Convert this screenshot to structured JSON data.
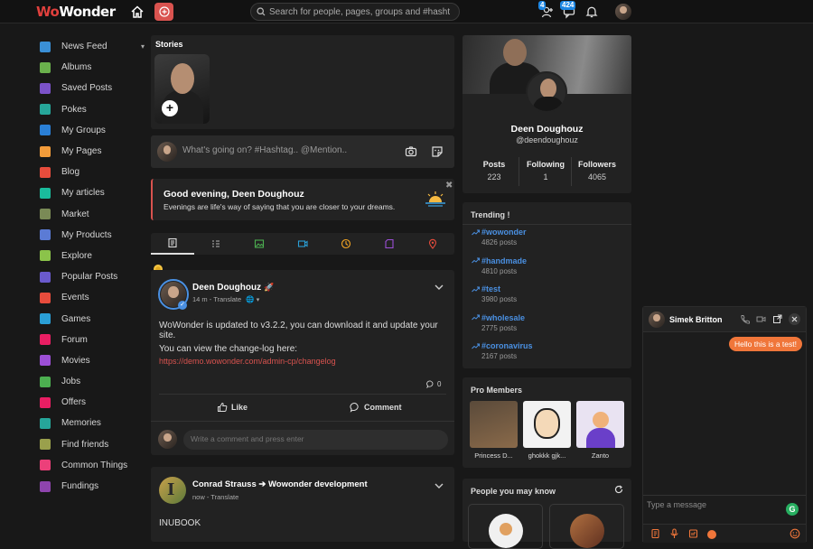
{
  "brand": {
    "logo_left": "Wo",
    "logo_right": "Wonder"
  },
  "topbar": {
    "search_placeholder": "Search for people, pages, groups and #hashtags",
    "friend_requests_count": "4",
    "messages_count": "424"
  },
  "sidebar": {
    "items": [
      {
        "label": "News Feed",
        "color": "#3a8fd6"
      },
      {
        "label": "Albums",
        "color": "#6ab04c"
      },
      {
        "label": "Saved Posts",
        "color": "#7b52c9"
      },
      {
        "label": "Pokes",
        "color": "#26a69a"
      },
      {
        "label": "My Groups",
        "color": "#2a7fd6"
      },
      {
        "label": "My Pages",
        "color": "#f39c3a"
      },
      {
        "label": "Blog",
        "color": "#e74c3c"
      },
      {
        "label": "My articles",
        "color": "#1abc9c"
      },
      {
        "label": "Market",
        "color": "#7a8a56"
      },
      {
        "label": "My Products",
        "color": "#5b7bd5"
      },
      {
        "label": "Explore",
        "color": "#8bc34a"
      },
      {
        "label": "Popular Posts",
        "color": "#6a5acd"
      },
      {
        "label": "Events",
        "color": "#e74c3c"
      },
      {
        "label": "Games",
        "color": "#2a9fd6"
      },
      {
        "label": "Forum",
        "color": "#e91e63"
      },
      {
        "label": "Movies",
        "color": "#9c4fd6"
      },
      {
        "label": "Jobs",
        "color": "#4caf50"
      },
      {
        "label": "Offers",
        "color": "#e91e63"
      },
      {
        "label": "Memories",
        "color": "#26a69a"
      },
      {
        "label": "Find friends",
        "color": "#9aa04c"
      },
      {
        "label": "Common Things",
        "color": "#ec407a"
      },
      {
        "label": "Fundings",
        "color": "#8e44ad"
      }
    ]
  },
  "stories": {
    "title": "Stories"
  },
  "composer": {
    "placeholder": "What's going on? #Hashtag.. @Mention.."
  },
  "greeting": {
    "title": "Good evening, Deen Doughouz",
    "subtitle": "Evenings are life's way of saying that you are closer to your dreams."
  },
  "post1": {
    "author": "Deen Doughouz",
    "meta": "14 m - Translate",
    "line1": "WoWonder is updated to v3.2.2, you can download it and update your site.",
    "line2": "You can view the change-log here:",
    "link": "https://demo.wowonder.com/admin-cp/changelog",
    "comment_count": "0",
    "like_label": "Like",
    "comment_label": "Comment",
    "comment_placeholder": "Write a comment and press enter"
  },
  "post2": {
    "author": "Conrad Strauss",
    "arrow": "➔",
    "group": "Wowonder development",
    "meta": "now - Translate",
    "text": "INUBOOK"
  },
  "profile": {
    "name": "Deen Doughouz",
    "handle": "@deendoughouz",
    "stats": [
      {
        "label": "Posts",
        "value": "223"
      },
      {
        "label": "Following",
        "value": "1"
      },
      {
        "label": "Followers",
        "value": "4065"
      }
    ]
  },
  "trending": {
    "title": "Trending !",
    "items": [
      {
        "tag": "#wowonder",
        "count": "4826 posts"
      },
      {
        "tag": "#handmade",
        "count": "4810 posts"
      },
      {
        "tag": "#test",
        "count": "3980 posts"
      },
      {
        "tag": "#wholesale",
        "count": "2775 posts"
      },
      {
        "tag": "#coronavirus",
        "count": "2167 posts"
      }
    ]
  },
  "pro_members": {
    "title": "Pro Members",
    "members": [
      {
        "name": "Princess D..."
      },
      {
        "name": "ghokkk gjk..."
      },
      {
        "name": "Zanto"
      }
    ]
  },
  "people": {
    "title": "People you may know"
  },
  "chat": {
    "name": "Simek Britton",
    "message": "Hello this is a test!",
    "input_placeholder": "Type a message"
  },
  "colors": {
    "accent": "#d9534f",
    "link_blue": "#4a90e2",
    "chat_bubble": "#f0763a"
  }
}
